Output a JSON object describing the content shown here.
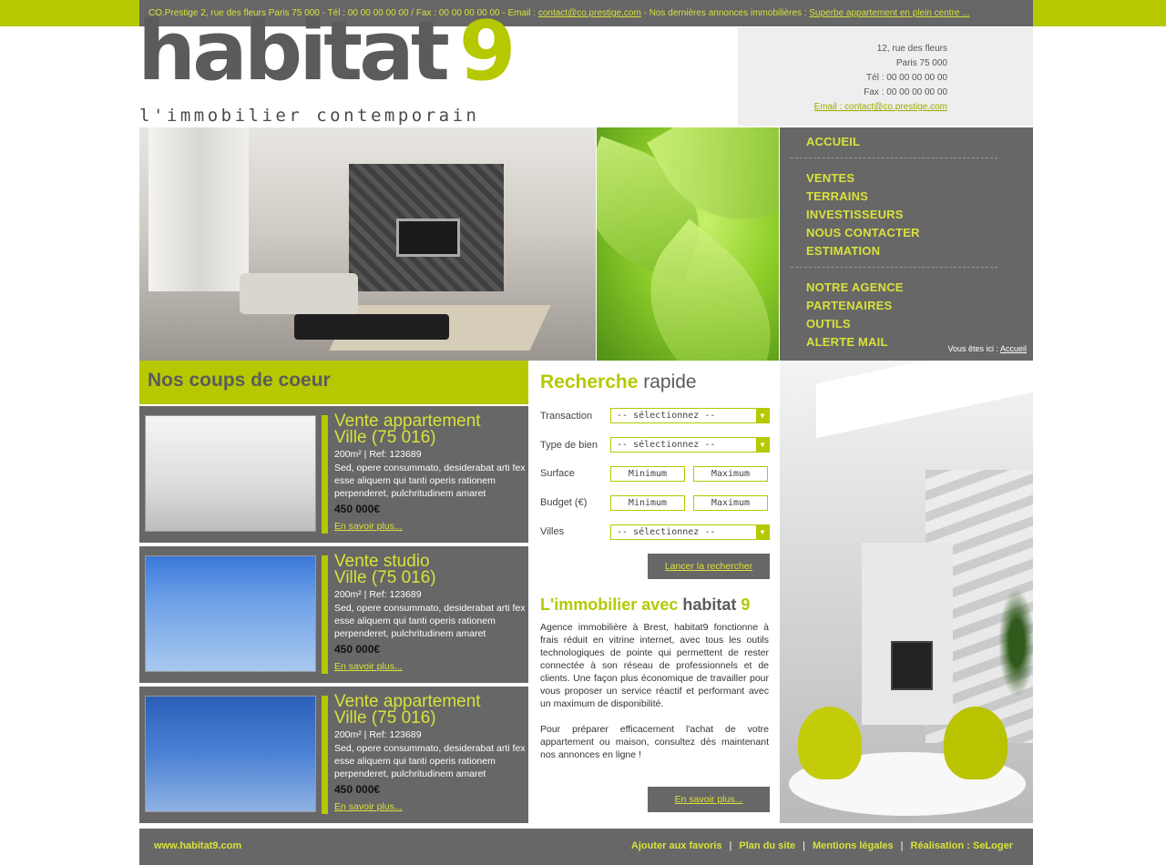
{
  "topbar": {
    "prefix": "CO.Prestige 2, rue des fleurs Paris 75 000 - Tél : 00 00 00 00 00 / Fax : 00 00 00 00 00 - Email : ",
    "email_link": "contact@co.prestige.com",
    "middle": " - Nos dernières annonces immobilières : ",
    "news_link": "Superbe appartement en plein centre ..."
  },
  "logo": {
    "word": "habitat",
    "number": "9",
    "tagline": "l'immobilier contemporain"
  },
  "contact": {
    "address": "12, rue des fleurs",
    "city": "Paris 75 000",
    "tel": "Tél : 00 00 00 00 00",
    "fax": "Fax : 00 00 00 00 00",
    "email": "Email : contact@co.prestige.com"
  },
  "nav": {
    "items": [
      "ACCUEIL",
      "VENTES",
      "TERRAINS",
      "INVESTISSEURS",
      "NOUS CONTACTER",
      "ESTIMATION",
      "NOTRE AGENCE",
      "PARTENAIRES",
      "OUTILS",
      "ALERTE MAIL"
    ],
    "breadcrumb_label": "Vous êtes ici : ",
    "breadcrumb_link": "Accueil"
  },
  "favorites": {
    "title": "Nos coups de coeur",
    "cards": [
      {
        "title_line1": "Vente appartement",
        "title_line2": "Ville (75 016)",
        "meta": "200m² | Ref: 123689",
        "desc": "Sed, opere consummato, desiderabat arti fex esse aliquem qui tanti operis rationem perpenderet, pulchritudinem amaret",
        "price": "450 000€",
        "more": "En savoir plus..."
      },
      {
        "title_line1": "Vente studio",
        "title_line2": "Ville (75 016)",
        "meta": "200m² | Ref: 123689",
        "desc": "Sed, opere consummato, desiderabat arti fex esse aliquem qui tanti operis rationem perpenderet, pulchritudinem amaret",
        "price": "450 000€",
        "more": "En savoir plus..."
      },
      {
        "title_line1": "Vente appartement",
        "title_line2": "Ville (75 016)",
        "meta": "200m² | Ref: 123689",
        "desc": "Sed, opere consummato, desiderabat arti fex esse aliquem qui tanti operis rationem perpenderet, pulchritudinem amaret",
        "price": "450 000€",
        "more": "En savoir plus..."
      }
    ]
  },
  "search": {
    "title_accent": "Recherche",
    "title_rest": " rapide",
    "transaction_label": "Transaction",
    "transaction_value": "-- sélectionnez --",
    "type_label": "Type de bien",
    "type_value": "-- sélectionnez --",
    "surface_label": "Surface",
    "surface_min": "Minimum",
    "surface_max": "Maximum",
    "budget_label": "Budget (€)",
    "budget_min": "Minimum",
    "budget_max": "Maximum",
    "villes_label": "Villes",
    "villes_value": "-- sélectionnez --",
    "submit": "Lancer la rechercher"
  },
  "about": {
    "title_accent": "L'immobilier avec",
    "title_dark": "habitat",
    "title_num": "9",
    "p1": "Agence immobilière à Brest, habitat9 fonctionne à frais réduit en vitrine internet, avec tous les outils technologiques de pointe qui permettent de rester connectée à son réseau de professionnels et de clients. Une façon plus économique de travailler pour vous proposer un service réactif et performant avec un maximum de disponibilité.",
    "p2": "Pour préparer efficacement l'achat de votre appartement ou maison, consultez dès maintenant nos annonces en ligne !",
    "more": "En savoir plus..."
  },
  "footer": {
    "site": "www.habitat9.com",
    "links": [
      "Ajouter aux favoris",
      "Plan du site",
      "Mentions légales",
      "Réalisation : SeLoger"
    ],
    "separator": "|"
  },
  "colors": {
    "accent": "#b5c800",
    "accent_text": "#d8e23a",
    "dark_gray": "#676767",
    "logo_gray": "#5b5b5b"
  }
}
